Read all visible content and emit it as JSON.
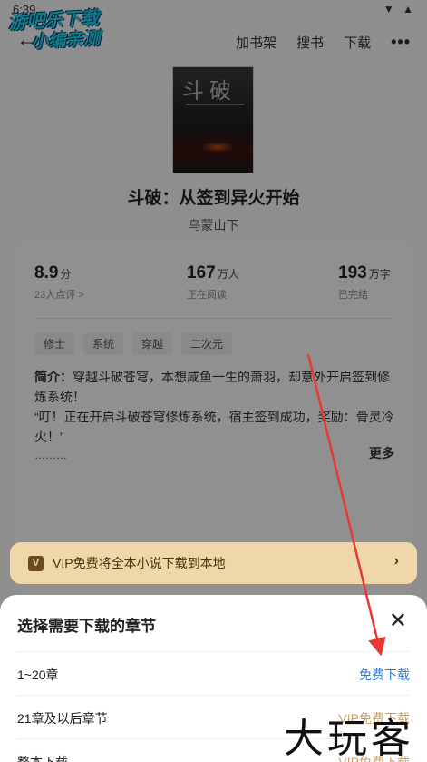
{
  "status": {
    "time": "6:39",
    "icons": "▼ ▲"
  },
  "watermark_logo": {
    "line1": "游吧乐下载",
    "line2": "小编亲测"
  },
  "header": {
    "actions": [
      "加书架",
      "搜书",
      "下载"
    ],
    "more_icon": "more-icon"
  },
  "book": {
    "cover_title": "斗破",
    "title": "斗破：从签到异火开始",
    "author": "乌蒙山下"
  },
  "stats": {
    "rating": {
      "value": "8.9",
      "unit": "分",
      "label": "23人点评 >"
    },
    "reading": {
      "value": "167",
      "unit": "万人",
      "label": "正在阅读"
    },
    "words": {
      "value": "193",
      "unit": "万字",
      "label": "已完结"
    }
  },
  "tags": [
    "修士",
    "系统",
    "穿越",
    "二次元"
  ],
  "description": {
    "prefix": "简介：",
    "line1": "穿越斗破苍穹，本想咸鱼一生的萧羽，却意外开启签到修炼系统！",
    "line2": "“叮！正在开启斗破苍穹修炼系统，宿主签到成功，奖励：骨灵冷火！”",
    "ellipsis": "………",
    "more": "更多"
  },
  "vip_banner": {
    "icon": "V",
    "text": "VIP免费将全本小说下载到本地",
    "chevron": "›"
  },
  "sheet": {
    "title": "选择需要下载的章节",
    "rows": [
      {
        "label": "1~20章",
        "action": "免费下载"
      },
      {
        "label": "21章及以后章节",
        "action": "VIP免费下载"
      },
      {
        "label": "整本下载",
        "action": "VIP免费下载"
      }
    ]
  },
  "brand_watermark": "大玩客",
  "colors": {
    "link": "#2b7de1",
    "vip": "#c9a064",
    "banner": "#f0d7a8",
    "arrow": "#e53935"
  }
}
